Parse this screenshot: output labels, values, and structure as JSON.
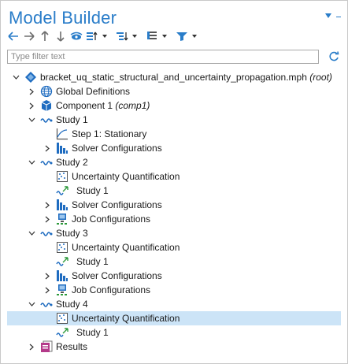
{
  "panel": {
    "title": "Model Builder"
  },
  "toolbar": {
    "icons": [
      "arrow-left-icon",
      "arrow-right-icon",
      "arrow-up-icon",
      "arrow-down-icon",
      "eye-icon",
      "sort-icon",
      "expand-icon",
      "list-icon",
      "filter-icon"
    ]
  },
  "filter": {
    "placeholder": "Type filter text",
    "value": ""
  },
  "tree": {
    "root": {
      "name": "bracket_uq_static_structural_and_uncertainty_propagation.mph",
      "suffix": "(root)"
    },
    "global_definitions": "Global Definitions",
    "component": {
      "name": "Component 1",
      "tag": "(comp1)"
    },
    "study1": {
      "label": "Study 1",
      "step": "Step 1: Stationary",
      "solver": "Solver Configurations"
    },
    "study2": {
      "label": "Study 2",
      "uq": "Uncertainty Quantification",
      "ref": "Study 1",
      "solver": "Solver Configurations",
      "job": "Job Configurations"
    },
    "study3": {
      "label": "Study 3",
      "uq": "Uncertainty Quantification",
      "ref": "Study 1",
      "solver": "Solver Configurations",
      "job": "Job Configurations"
    },
    "study4": {
      "label": "Study 4",
      "uq": "Uncertainty Quantification",
      "ref": "Study 1"
    },
    "results": "Results"
  },
  "colors": {
    "accent": "#2a7dc9",
    "selection": "#cce4f7"
  }
}
